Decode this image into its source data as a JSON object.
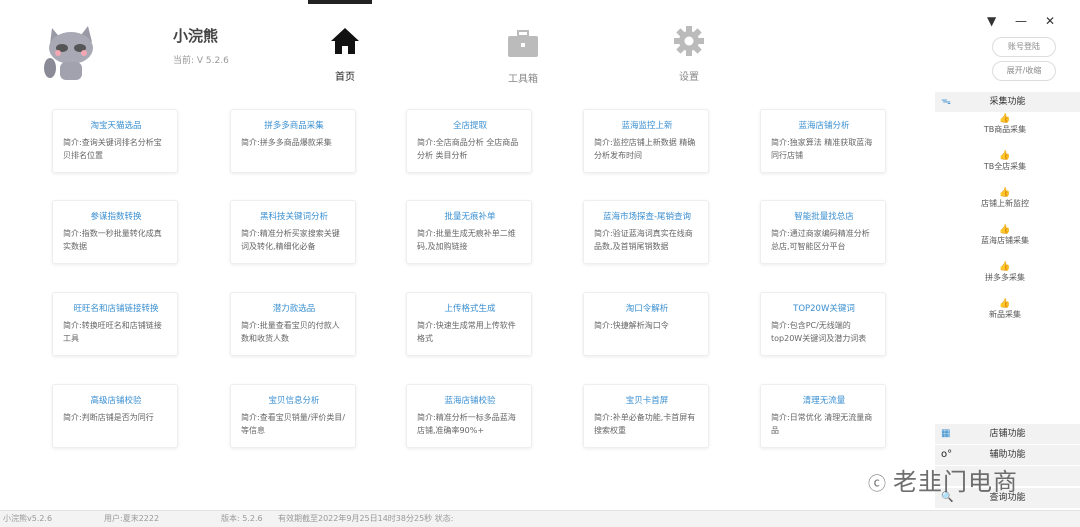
{
  "app": {
    "name": "小浣熊",
    "version": "当前: V 5.2.6"
  },
  "nav": [
    {
      "label": "首页",
      "icon": "home-icon"
    },
    {
      "label": "工具箱",
      "icon": "toolbox-icon"
    },
    {
      "label": "设置",
      "icon": "gear-icon"
    }
  ],
  "cards": [
    {
      "title": "淘宝天猫选品",
      "desc": "简介:查询关键词排名分析宝贝排名位置"
    },
    {
      "title": "拼多多商品采集",
      "desc": "简介:拼多多商品爆款采集"
    },
    {
      "title": "全店提取",
      "desc": "简介:全店商品分析 全店商品分析 类目分析"
    },
    {
      "title": "蓝海监控上新",
      "desc": "简介:监控店铺上新数据 精确分析发布时间"
    },
    {
      "title": "蓝海店铺分析",
      "desc": "简介:独家算法 精准获取蓝海同行店铺"
    },
    {
      "title": "参谋指数转换",
      "desc": "简介:指数一秒批量转化成真实数据"
    },
    {
      "title": "黑科技关键词分析",
      "desc": "简介:精准分析买家搜索关键词及转化,精细化必备"
    },
    {
      "title": "批量无痕补单",
      "desc": "简介:批量生成无痕补单二维码,及加购链接"
    },
    {
      "title": "蓝海市场探查-尾销查询",
      "desc": "简介:验证蓝海词真实在线商品数,及首销尾销数据"
    },
    {
      "title": "智能批量找总店",
      "desc": "简介:通过商家编码精准分析总店,可智能区分平台"
    },
    {
      "title": "旺旺名和店铺链接转换",
      "desc": " 简介:转换旺旺名和店铺链接工具"
    },
    {
      "title": "潜力款选品",
      "desc": "简介:批量查看宝贝的付款人数和收货人数"
    },
    {
      "title": "上传格式生成",
      "desc": " 简介:快速生成常用上传软件格式"
    },
    {
      "title": "淘口令解析",
      "desc": "简介:快捷解析淘口令"
    },
    {
      "title": "TOP20W关键词",
      "desc": "简介:包含PC/无线端的top20W关键词及潜力词表"
    },
    {
      "title": "高级店铺校验",
      "desc": "简介:判断店铺是否为同行"
    },
    {
      "title": "宝贝信息分析",
      "desc": "简介:查看宝贝销量/评价类目/等信息"
    },
    {
      "title": "蓝海店铺校验",
      "desc": "简介:精准分析一标多品蓝海店铺,准确率90%+"
    },
    {
      "title": "宝贝卡首屏",
      "desc": "简介:补单必备功能,卡首屏有搜索权重"
    },
    {
      "title": "清理无流量",
      "desc": "简介:日常优化 清理无流量商品"
    }
  ],
  "right": {
    "window_controls": {
      "menu": "▼",
      "minimize": "—",
      "close": "✕"
    },
    "buttons": {
      "logout": "账号登陆",
      "toggle": "展开/收缩"
    },
    "collect_section": "采集功能",
    "collect_items": [
      "TB商品采集",
      "TB全店采集",
      "店铺上新监控",
      "蓝海店铺采集",
      "拼多多采集",
      "新品采集"
    ],
    "bottom_sections": [
      "店铺功能",
      "辅助功能",
      "",
      "查询功能"
    ]
  },
  "status": {
    "app": "小浣熊v5.2.6",
    "user": "用户:夏末2222",
    "version": "版本: 5.2.6",
    "expiry": "有效期截至2022年9月25日14时38分25秒 状态:"
  },
  "watermark": "老韭门电商"
}
